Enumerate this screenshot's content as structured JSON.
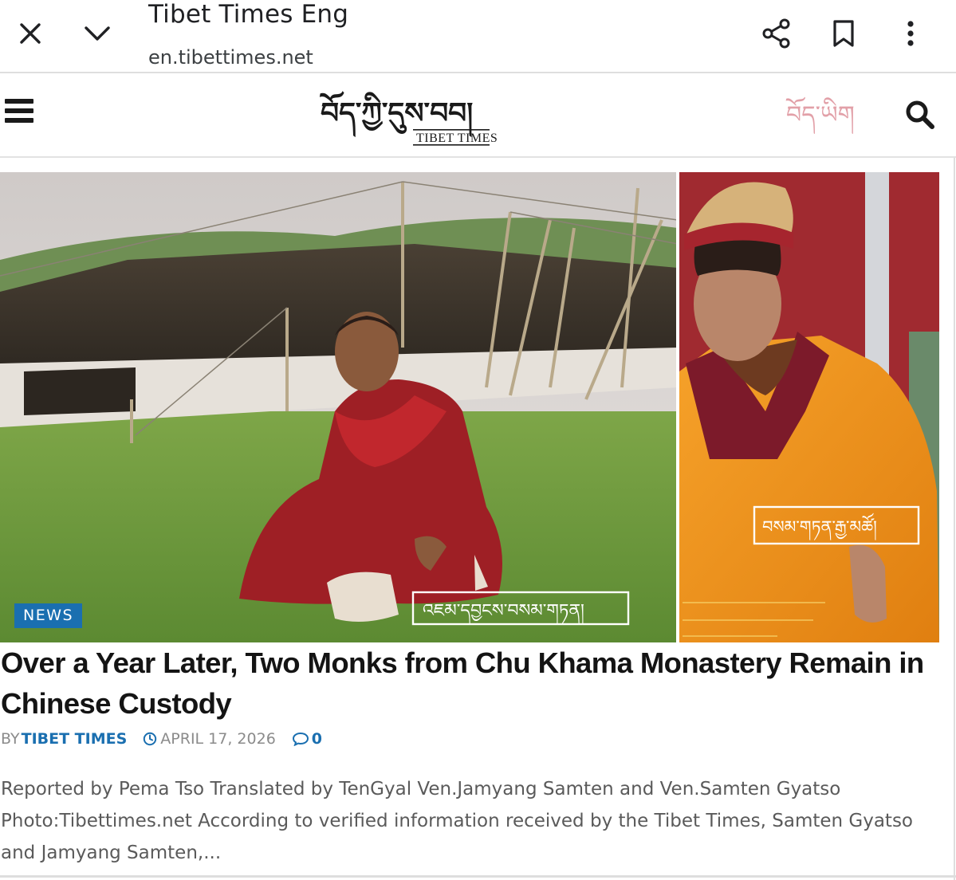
{
  "browser": {
    "title": "Tibet Times Eng",
    "url": "en.tibettimes.net",
    "icons": [
      "close-icon",
      "chevron-down-icon",
      "share-icon",
      "bookmark-icon",
      "more-vert-icon"
    ]
  },
  "header": {
    "logo_tibetan": "བོད་ཀྱི་དུས་བབ།",
    "logo_english": "TIBET TIMES",
    "lang_label": "བོད་ཡིག",
    "icons": [
      "menu-icon",
      "search-icon"
    ],
    "colors": {
      "lang": "#e2a0a8",
      "logo": "#1a1a1a"
    }
  },
  "article": {
    "category": "NEWS",
    "photo_caption_left": "འཇམ་དབྱངས་བསམ་གཏན།",
    "photo_caption_right": "བསམ་གཏན་རྒྱ་མཚོ།",
    "title": "Over a Year Later, Two Monks from Chu Khama Monastery Remain in Chinese Custody",
    "by_label": "BY",
    "author": "TIBET TIMES",
    "date": "APRIL 17, 2026",
    "comments": "0",
    "excerpt": "Reported by Pema Tso Translated by TenGyal Ven.Jamyang Samten and Ven.Samten Gyatso Photo:Tibettimes.net According to verified information received by the Tibet Times,  Samten Gyatso and Jamyang Samten,...",
    "colors": {
      "accent": "#1a6fb0",
      "tag_bg": "#1a6fb0",
      "robe_red": "#9e1f25",
      "robe_orange": "#f39a1e"
    }
  }
}
